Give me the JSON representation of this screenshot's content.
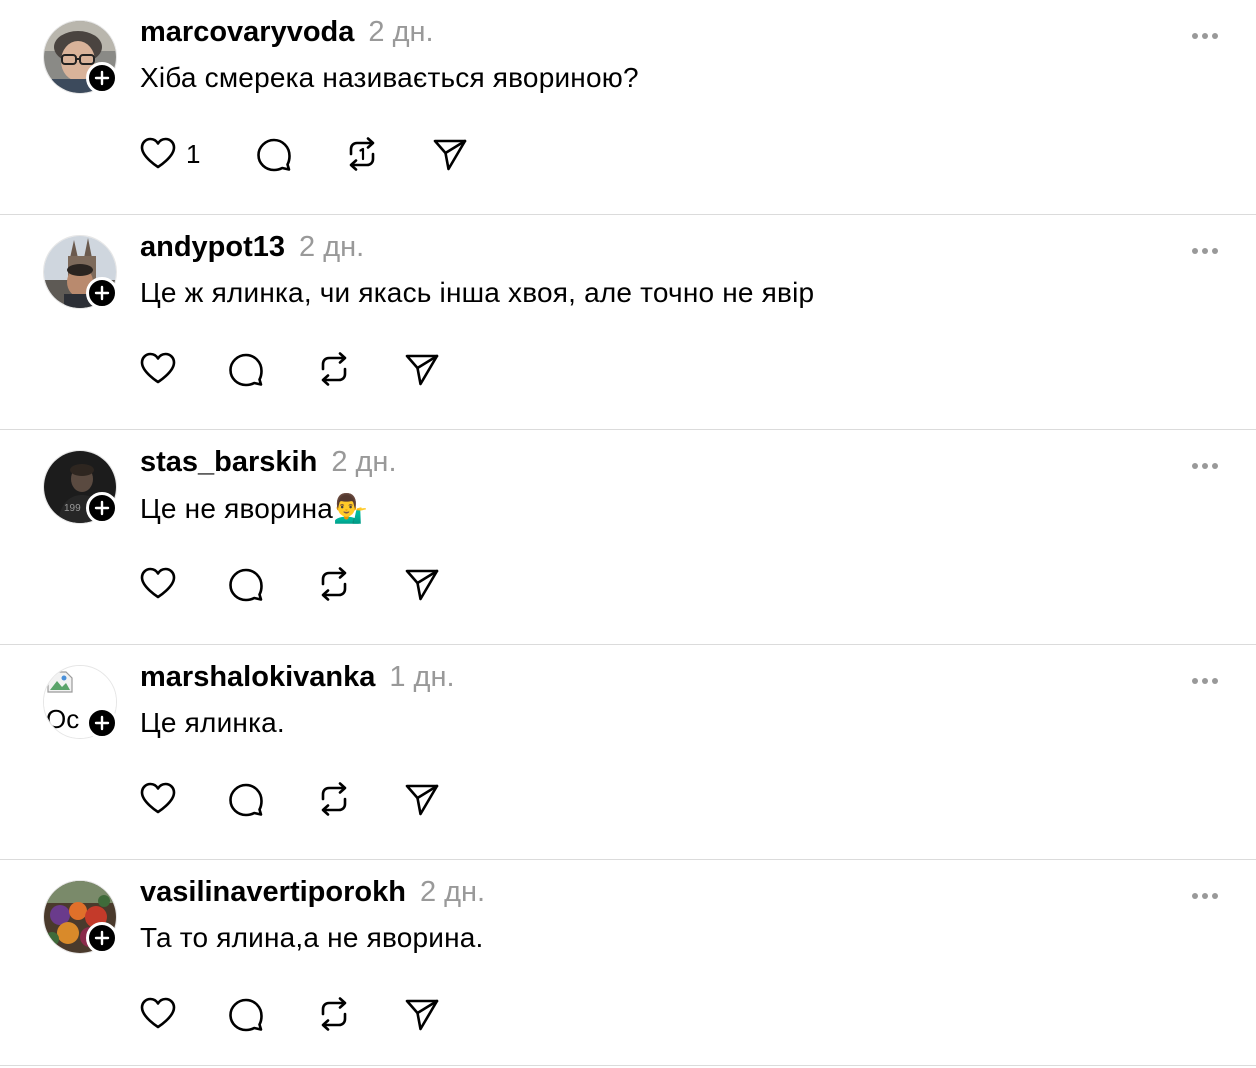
{
  "posts": [
    {
      "username": "marcovaryvoda",
      "time": "2 дн.",
      "text": "Хіба смерека називається явориною?",
      "likes": "1",
      "avatar": "photo-man-glasses"
    },
    {
      "username": "andypot13",
      "time": "2 дн.",
      "text": "Це ж ялинка, чи якась інша хвоя, але точно не явір",
      "likes": "",
      "avatar": "photo-man-cathedral"
    },
    {
      "username": "stas_barskih",
      "time": "2 дн.",
      "text": "Це не яворина💁‍♂️",
      "likes": "",
      "avatar": "photo-man-dark"
    },
    {
      "username": "marshalokivanka",
      "time": "1 дн.",
      "text": "Це ялинка.",
      "likes": "",
      "avatar": "broken-image",
      "avatar_alt": "Ос"
    },
    {
      "username": "vasilinavertiporokh",
      "time": "2 дн.",
      "text": "Та то ялина,а не яворина.",
      "likes": "",
      "avatar": "photo-flowers"
    }
  ],
  "icons": {
    "follow": "plus-icon",
    "more": "more-horizontal-icon",
    "like": "heart-icon",
    "reply": "comment-bubble-icon",
    "repost": "repost-icon",
    "share": "send-icon"
  },
  "colors": {
    "text": "#000000",
    "muted": "#999999",
    "divider": "#dbdbdb"
  }
}
